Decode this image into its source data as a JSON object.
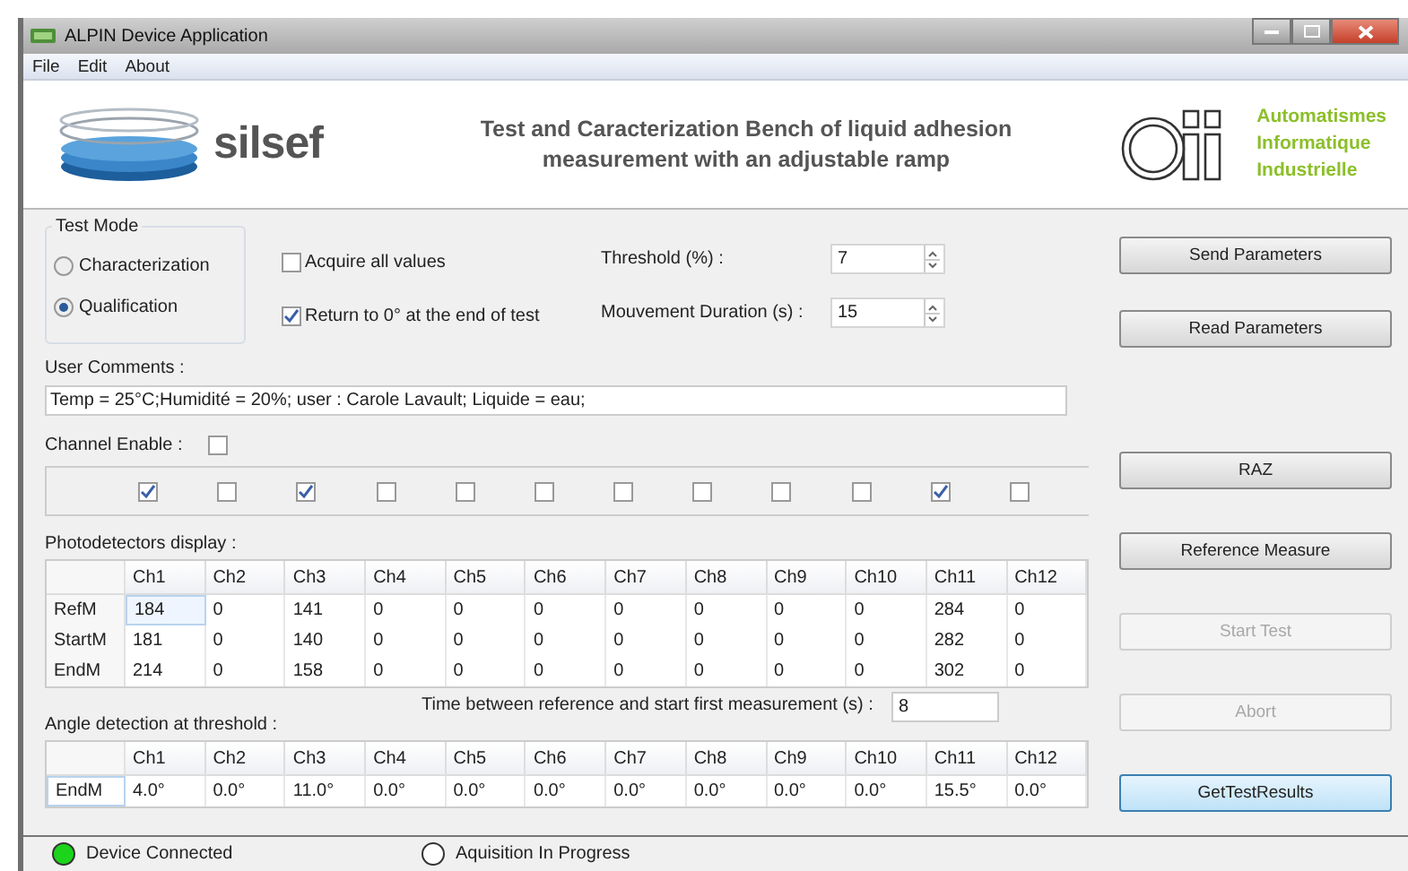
{
  "window": {
    "title": "ALPIN Device Application"
  },
  "menu": [
    "File",
    "Edit",
    "About"
  ],
  "header": {
    "left_logo": "silsef",
    "title": "Test and Caracterization Bench of liquid adhesion measurement with an adjustable ramp",
    "right_logo": [
      "Automatismes",
      "Informatique",
      "Industrielle"
    ]
  },
  "test_mode": {
    "title": "Test Mode",
    "options": [
      {
        "label": "Characterization",
        "selected": false
      },
      {
        "label": "Qualification",
        "selected": true
      }
    ]
  },
  "options": [
    {
      "label": "Acquire all values",
      "checked": false
    },
    {
      "label": "Return to 0° at the end of test",
      "checked": true
    }
  ],
  "parameters": [
    {
      "label": "Threshold (%) :",
      "value": "7"
    },
    {
      "label": "Mouvement Duration (s) :",
      "value": "15"
    }
  ],
  "user_comments": {
    "label": "User Comments :",
    "value": "Temp = 25°C;Humidité = 20%; user : Carole Lavault; Liquide = eau;"
  },
  "channel_enable": {
    "label": "Channel Enable :",
    "checked": false,
    "channels": [
      {
        "checked": true
      },
      {
        "checked": false
      },
      {
        "checked": true
      },
      {
        "checked": false
      },
      {
        "checked": false
      },
      {
        "checked": false
      },
      {
        "checked": false
      },
      {
        "checked": false
      },
      {
        "checked": false
      },
      {
        "checked": false
      },
      {
        "checked": true
      },
      {
        "checked": false
      }
    ]
  },
  "photodetectors": {
    "label": "Photodetectors display :",
    "columns": [
      "Ch1",
      "Ch2",
      "Ch3",
      "Ch4",
      "Ch5",
      "Ch6",
      "Ch7",
      "Ch8",
      "Ch9",
      "Ch10",
      "Ch11",
      "Ch12"
    ],
    "rows": [
      {
        "header": "RefM",
        "selected": false,
        "cells": [
          {
            "text": "184",
            "selected": true
          },
          {
            "text": "0",
            "selected": false
          },
          {
            "text": "141",
            "selected": false
          },
          {
            "text": "0",
            "selected": false
          },
          {
            "text": "0",
            "selected": false
          },
          {
            "text": "0",
            "selected": false
          },
          {
            "text": "0",
            "selected": false
          },
          {
            "text": "0",
            "selected": false
          },
          {
            "text": "0",
            "selected": false
          },
          {
            "text": "0",
            "selected": false
          },
          {
            "text": "284",
            "selected": false
          },
          {
            "text": "0",
            "selected": false
          }
        ]
      },
      {
        "header": "StartM",
        "selected": false,
        "cells": [
          {
            "text": "181",
            "selected": false
          },
          {
            "text": "0",
            "selected": false
          },
          {
            "text": "140",
            "selected": false
          },
          {
            "text": "0",
            "selected": false
          },
          {
            "text": "0",
            "selected": false
          },
          {
            "text": "0",
            "selected": false
          },
          {
            "text": "0",
            "selected": false
          },
          {
            "text": "0",
            "selected": false
          },
          {
            "text": "0",
            "selected": false
          },
          {
            "text": "0",
            "selected": false
          },
          {
            "text": "282",
            "selected": false
          },
          {
            "text": "0",
            "selected": false
          }
        ]
      },
      {
        "header": "EndM",
        "selected": false,
        "cells": [
          {
            "text": "214",
            "selected": false
          },
          {
            "text": "0",
            "selected": false
          },
          {
            "text": "158",
            "selected": false
          },
          {
            "text": "0",
            "selected": false
          },
          {
            "text": "0",
            "selected": false
          },
          {
            "text": "0",
            "selected": false
          },
          {
            "text": "0",
            "selected": false
          },
          {
            "text": "0",
            "selected": false
          },
          {
            "text": "0",
            "selected": false
          },
          {
            "text": "0",
            "selected": false
          },
          {
            "text": "302",
            "selected": false
          },
          {
            "text": "0",
            "selected": false
          }
        ]
      }
    ]
  },
  "time_between": {
    "label": "Time between reference and start first measurement (s)  :",
    "value": "8"
  },
  "angle_detection": {
    "label": "Angle detection at threshold :",
    "columns": [
      "Ch1",
      "Ch2",
      "Ch3",
      "Ch4",
      "Ch5",
      "Ch6",
      "Ch7",
      "Ch8",
      "Ch9",
      "Ch10",
      "Ch11",
      "Ch12"
    ],
    "rows": [
      {
        "header": "EndM",
        "selected": true,
        "cells": [
          {
            "text": "4.0°",
            "selected": false
          },
          {
            "text": "0.0°",
            "selected": false
          },
          {
            "text": "11.0°",
            "selected": false
          },
          {
            "text": "0.0°",
            "selected": false
          },
          {
            "text": "0.0°",
            "selected": false
          },
          {
            "text": "0.0°",
            "selected": false
          },
          {
            "text": "0.0°",
            "selected": false
          },
          {
            "text": "0.0°",
            "selected": false
          },
          {
            "text": "0.0°",
            "selected": false
          },
          {
            "text": "0.0°",
            "selected": false
          },
          {
            "text": "15.5°",
            "selected": false
          },
          {
            "text": "0.0°",
            "selected": false
          }
        ]
      }
    ]
  },
  "buttons": [
    {
      "label": "Send Parameters",
      "disabled": false,
      "focused": false
    },
    {
      "label": "Read Parameters",
      "disabled": false,
      "focused": false
    },
    {
      "label": "RAZ",
      "disabled": false,
      "focused": false
    },
    {
      "label": "Reference Measure",
      "disabled": false,
      "focused": false
    },
    {
      "label": "Start Test",
      "disabled": true,
      "focused": false
    },
    {
      "label": "Abort",
      "disabled": true,
      "focused": false
    },
    {
      "label": "GetTestResults",
      "disabled": false,
      "focused": true
    }
  ],
  "status_bar": [
    {
      "label": "Device Connected",
      "on": true
    },
    {
      "label": "Aquisition In Progress",
      "on": false
    }
  ]
}
